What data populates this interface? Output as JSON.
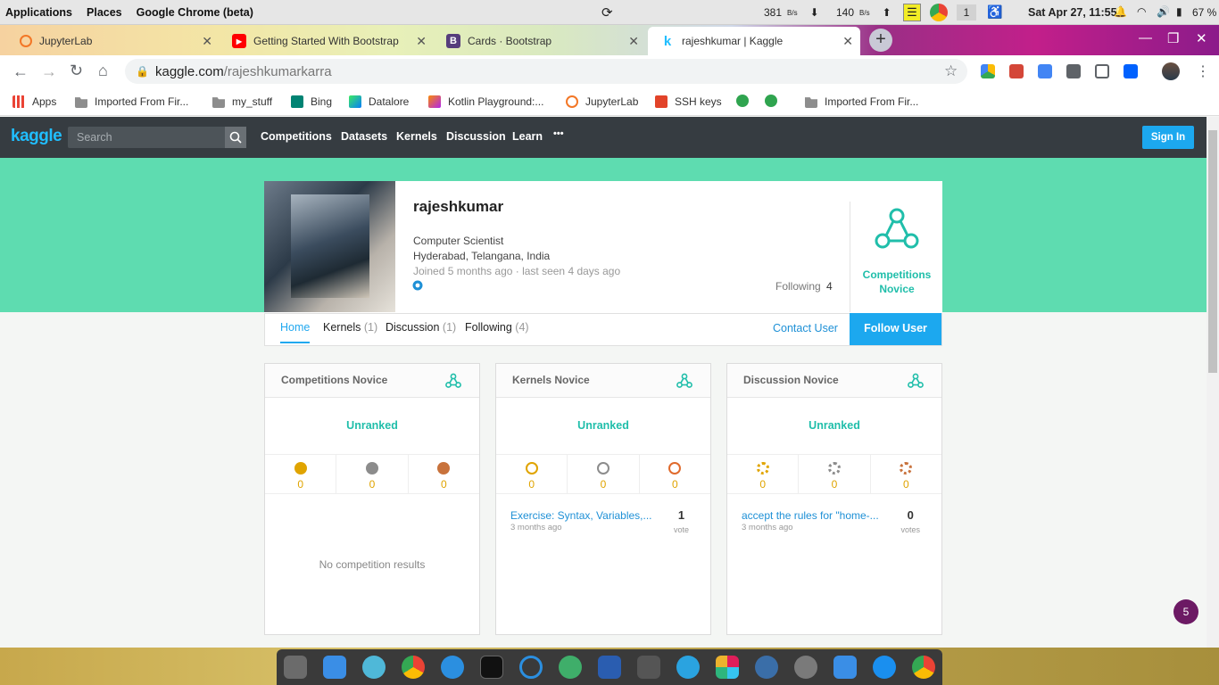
{
  "system_bar": {
    "applications": "Applications",
    "places": "Places",
    "active_app": "Google Chrome (beta)",
    "net_down_value": "381",
    "net_down_unit": "B/s",
    "net_up_value": "140",
    "net_up_unit": "B/s",
    "workspace": "1",
    "datetime": "Sat Apr 27, 11:55",
    "battery": "67 %"
  },
  "tabs": [
    {
      "title": "JupyterLab",
      "icon": "jupyter-icon",
      "active": false
    },
    {
      "title": "Getting Started With Bootstrap",
      "icon": "youtube-icon",
      "active": false
    },
    {
      "title": "Cards · Bootstrap",
      "icon": "bootstrap-icon",
      "active": false
    },
    {
      "title": "rajeshkumar | Kaggle",
      "icon": "kaggle-icon",
      "active": true
    }
  ],
  "omnibox": {
    "url_host": "kaggle.com",
    "url_path": "/rajeshkumarkarra"
  },
  "bookmarks": [
    {
      "label": "Apps",
      "icon": "apps-grid-icon"
    },
    {
      "label": "Imported From Fir...",
      "icon": "folder-icon"
    },
    {
      "label": "my_stuff",
      "icon": "folder-icon"
    },
    {
      "label": "Bing",
      "icon": "bing-icon"
    },
    {
      "label": "Datalore",
      "icon": "datalore-icon"
    },
    {
      "label": "Kotlin Playground:...",
      "icon": "kotlin-icon"
    },
    {
      "label": "JupyterLab",
      "icon": "jupyter-icon"
    },
    {
      "label": "SSH keys",
      "icon": "ssh-icon"
    },
    {
      "label": "Imported From Fir...",
      "icon": "folder-icon"
    }
  ],
  "kaggle_nav": {
    "logo": "kaggle",
    "search_placeholder": "Search",
    "links": [
      "Competitions",
      "Datasets",
      "Kernels",
      "Discussion",
      "Learn"
    ],
    "more": "•••",
    "sign_in": "Sign In"
  },
  "profile": {
    "name": "rajeshkumar",
    "title": "Computer Scientist",
    "location": "Hyderabad, Telangana, India",
    "joined": "Joined 5 months ago · last seen 4 days ago",
    "following_label": "Following",
    "following_count": "4",
    "tier_line1": "Competitions",
    "tier_line2": "Novice"
  },
  "profile_tabs": [
    {
      "label": "Home",
      "count": ""
    },
    {
      "label": "Kernels",
      "count": "(1)"
    },
    {
      "label": "Discussion",
      "count": "(1)"
    },
    {
      "label": "Following",
      "count": "(4)"
    }
  ],
  "actions": {
    "contact": "Contact User",
    "follow": "Follow User"
  },
  "tier_cards": [
    {
      "title": "Competitions Novice",
      "rank": "Unranked",
      "medals": {
        "gold": "0",
        "silver": "0",
        "bronze": "0"
      },
      "empty_text": "No competition results"
    },
    {
      "title": "Kernels Novice",
      "rank": "Unranked",
      "medals": {
        "gold": "0",
        "silver": "0",
        "bronze": "0"
      },
      "item_title": "Exercise: Syntax, Variables,...",
      "item_when": "3 months ago",
      "votes": "1",
      "votes_label": "vote"
    },
    {
      "title": "Discussion Novice",
      "rank": "Unranked",
      "medals": {
        "gold": "0",
        "silver": "0",
        "bronze": "0"
      },
      "item_title": "accept the rules for \"home-...",
      "item_when": "3 months ago",
      "votes": "0",
      "votes_label": "votes"
    }
  ],
  "notification_count": "5",
  "colors": {
    "kaggle_blue": "#20beff",
    "tier_green": "#20beaa",
    "profile_band": "#5edcb0",
    "gold": "#e0a400",
    "silver": "#9e9e9e",
    "bronze": "#c8723c"
  }
}
